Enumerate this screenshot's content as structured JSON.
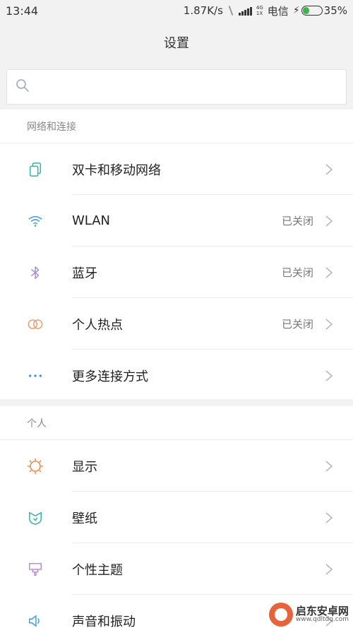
{
  "status_bar": {
    "time": "13:44",
    "net_speed": "1.87K/s",
    "net_type_top": "4G",
    "net_type_bottom": "1X",
    "carrier": "电信",
    "battery": "35%",
    "battery_level": 0.35
  },
  "title": "设置",
  "search": {
    "placeholder": ""
  },
  "sections": [
    {
      "header": "网络和连接",
      "items": [
        {
          "label": "双卡和移动网络",
          "value": "",
          "icon": "dual-sim-icon"
        },
        {
          "label": "WLAN",
          "value": "已关闭",
          "icon": "wifi-icon"
        },
        {
          "label": "蓝牙",
          "value": "已关闭",
          "icon": "bluetooth-icon"
        },
        {
          "label": "个人热点",
          "value": "已关闭",
          "icon": "hotspot-icon"
        },
        {
          "label": "更多连接方式",
          "value": "",
          "icon": "more-dots-icon"
        }
      ]
    },
    {
      "header": "个人",
      "items": [
        {
          "label": "显示",
          "value": "",
          "icon": "brightness-icon"
        },
        {
          "label": "壁纸",
          "value": "",
          "icon": "wallpaper-icon"
        },
        {
          "label": "个性主题",
          "value": "",
          "icon": "theme-brush-icon"
        },
        {
          "label": "声音和振动",
          "value": "",
          "icon": "speaker-icon"
        }
      ]
    }
  ],
  "watermark": {
    "name": "启东安卓网",
    "url": "www.qdltdq.com"
  },
  "colors": {
    "sim": "#2bb5a6",
    "wifi": "#3a9ee8",
    "bluetooth": "#a58be0",
    "hotspot": "#f09a6a",
    "more": "#3a8ee8",
    "display": "#f08a4a",
    "wallpaper": "#2bb5a6",
    "theme": "#b98ae0",
    "sound": "#3a9ee8"
  }
}
